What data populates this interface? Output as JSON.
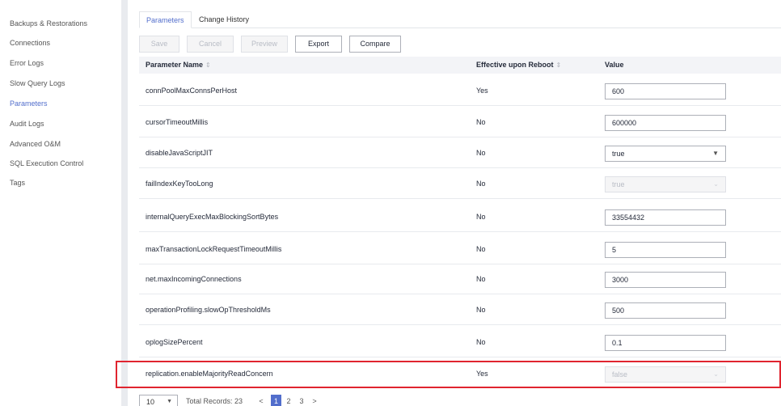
{
  "sidebar": {
    "items": [
      {
        "label": "Backups & Restorations",
        "active": false
      },
      {
        "label": "Connections",
        "active": false
      },
      {
        "label": "Error Logs",
        "active": false
      },
      {
        "label": "Slow Query Logs",
        "active": false
      },
      {
        "label": "Parameters",
        "active": true
      },
      {
        "label": "Audit Logs",
        "active": false
      },
      {
        "label": "Advanced O&M",
        "active": false
      },
      {
        "label": "SQL Execution Control",
        "active": false
      },
      {
        "label": "Tags",
        "active": false
      }
    ]
  },
  "tabs": [
    {
      "label": "Parameters",
      "active": true
    },
    {
      "label": "Change History",
      "active": false
    }
  ],
  "toolbar": {
    "save": "Save",
    "cancel": "Cancel",
    "preview": "Preview",
    "export": "Export",
    "compare": "Compare"
  },
  "table": {
    "headers": {
      "name": "Parameter Name",
      "reboot": "Effective upon Reboot",
      "value": "Value"
    },
    "sort_icon": "⇕",
    "rows": [
      {
        "name": "connPoolMaxConnsPerHost",
        "reboot": "Yes",
        "value": "600",
        "control": "input"
      },
      {
        "name": "cursorTimeoutMillis",
        "reboot": "No",
        "value": "600000",
        "control": "input"
      },
      {
        "name": "disableJavaScriptJIT",
        "reboot": "No",
        "value": "true",
        "control": "select"
      },
      {
        "name": "failIndexKeyTooLong",
        "reboot": "No",
        "value": "true",
        "control": "select-disabled"
      },
      {
        "name": "internalQueryExecMaxBlockingSortBytes",
        "reboot": "No",
        "value": "33554432",
        "control": "input"
      },
      {
        "name": "maxTransactionLockRequestTimeoutMillis",
        "reboot": "No",
        "value": "5",
        "control": "input"
      },
      {
        "name": "net.maxIncomingConnections",
        "reboot": "No",
        "value": "3000",
        "control": "input"
      },
      {
        "name": "operationProfiling.slowOpThresholdMs",
        "reboot": "No",
        "value": "500",
        "control": "input"
      },
      {
        "name": "oplogSizePercent",
        "reboot": "No",
        "value": "0.1",
        "control": "input"
      },
      {
        "name": "replication.enableMajorityReadConcern",
        "reboot": "Yes",
        "value": "false",
        "control": "select-disabled"
      }
    ]
  },
  "pagination": {
    "page_size": "10",
    "total": "Total Records: 23",
    "prev": "<",
    "pages": [
      "1",
      "2",
      "3"
    ],
    "current": "1",
    "next": ">"
  },
  "colors": {
    "accent": "#526ecc",
    "highlight": "#e0242f"
  }
}
